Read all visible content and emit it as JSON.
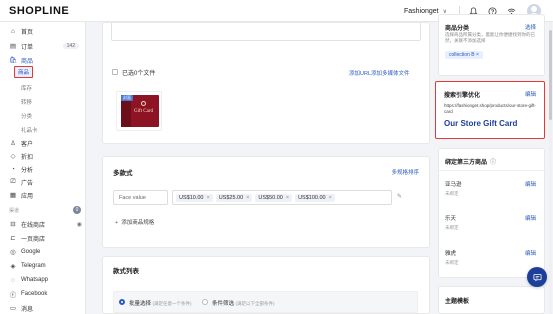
{
  "header": {
    "logo": "SHOPLINE",
    "store_name": "Fashionget",
    "store_chevron": "∨",
    "icons": [
      "bell-icon",
      "help-icon",
      "wifi-icon",
      "avatar"
    ]
  },
  "sidebar": {
    "items": [
      {
        "icon": "home-icon",
        "label": "首页"
      },
      {
        "icon": "order-icon",
        "label": "订单",
        "badge": "142"
      },
      {
        "icon": "bag-icon",
        "label": "商品"
      },
      {
        "icon": "customer-icon",
        "label": "客户"
      },
      {
        "icon": "discount-icon",
        "label": "折扣"
      },
      {
        "icon": "analytics-icon",
        "label": "分析"
      },
      {
        "icon": "ads-icon",
        "label": "广告"
      },
      {
        "icon": "apps-icon",
        "label": "应用"
      }
    ],
    "product_subitems": [
      "商品",
      "库存",
      "转移",
      "分类",
      "礼品卡"
    ],
    "channels_label": "渠道",
    "channels_badge": "0",
    "channels": [
      {
        "icon": "store-icon",
        "label": "在线商店"
      },
      {
        "icon": "pos-icon",
        "label": "一页商店"
      },
      {
        "icon": "google-icon",
        "label": "Google"
      },
      {
        "icon": "telegram-icon",
        "label": "Telegram"
      },
      {
        "icon": "whatsapp-icon",
        "label": "Whatsapp"
      },
      {
        "icon": "facebook-icon",
        "label": "Facebook"
      },
      {
        "icon": "message-icon",
        "label": "消息"
      }
    ]
  },
  "media": {
    "selected_text": "已选0个文件",
    "add_url": "添加URL",
    "add_media": "添加多媒体文件",
    "tile_tag": "封面",
    "gift_text": "Gift Card"
  },
  "variants": {
    "title": "多款式",
    "sort_link": "多规格排序",
    "option_name": "Face value",
    "values": [
      "US$10.00",
      "US$25.00",
      "US$50.00",
      "US$100.00"
    ],
    "remove_glyph": "×",
    "add_label": "添加商品规格"
  },
  "variant_list": {
    "title": "款式列表",
    "radio1": "批量选择",
    "radio1_hint": "(满足任意一个条件)",
    "radio2": "条件筛选",
    "radio2_hint": "(满足以下全部条件)"
  },
  "right": {
    "category": {
      "title": "商品分类",
      "link": "选择",
      "desc": "选择商品所属分类，着能让你便捷找到你的已然，关联不添加选择",
      "tag": "collection B",
      "tag_x": "×"
    },
    "seo": {
      "title": "搜索引擎优化",
      "edit": "编辑",
      "url": "https://fashionget.shop/products/our-store-gift-card",
      "page_title": "Our Store Gift Card"
    },
    "third_party": {
      "title": "绑定第三方商品",
      "info_icon": "ⓘ",
      "channels": [
        {
          "name": "亚马逊",
          "status": "未绑定",
          "edit": "编辑"
        },
        {
          "name": "乐天",
          "status": "未绑定",
          "edit": "编辑"
        },
        {
          "name": "雅虎",
          "status": "未绑定",
          "edit": "编辑"
        }
      ]
    },
    "theme": {
      "title": "主题模板"
    }
  },
  "colors": {
    "accent": "#2b59c3",
    "highlight_border": "#e53935",
    "gift_card": "#8d1424"
  }
}
